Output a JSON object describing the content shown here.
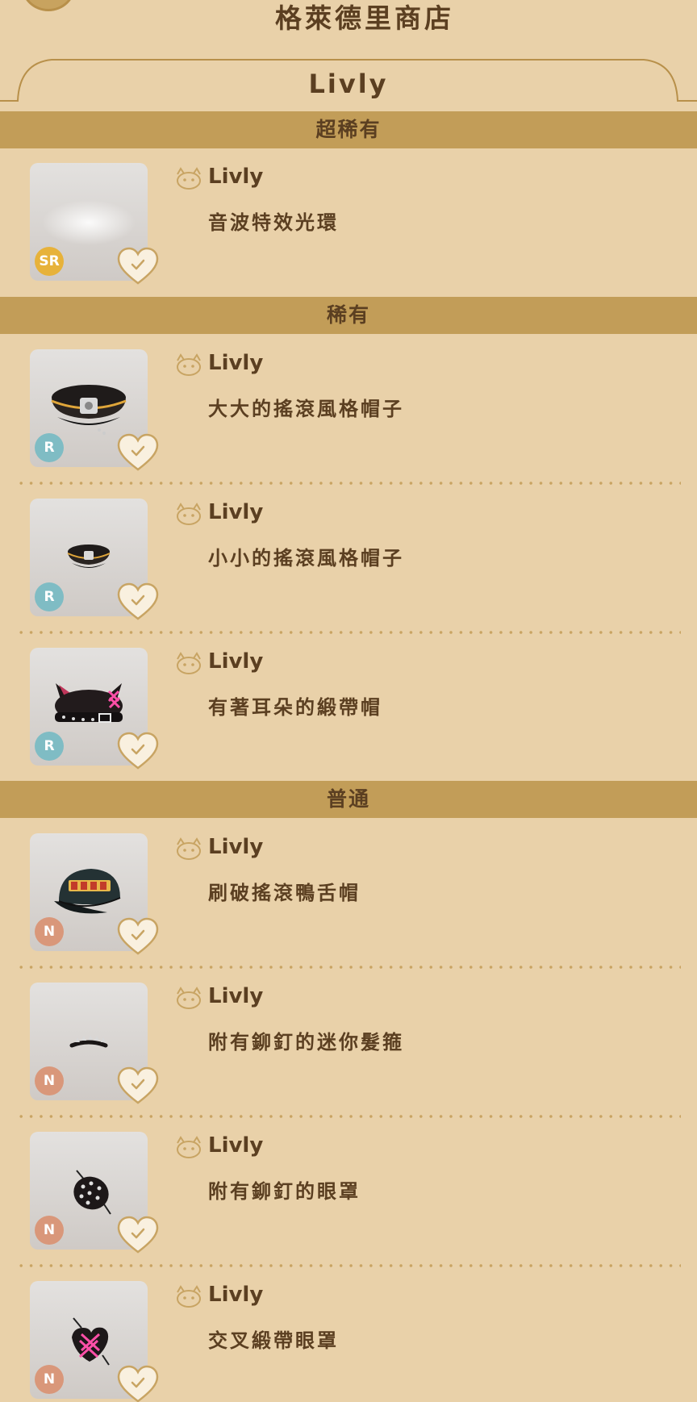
{
  "header": {
    "title": "格萊德里商店"
  },
  "tab": {
    "label": "Livly"
  },
  "colors": {
    "background": "#e9d1a9",
    "section_bar": "#c29d58",
    "text": "#5b3f21",
    "rarity_SR": "#e7b23a",
    "rarity_R": "#7fbcc4",
    "rarity_N": "#d9977a"
  },
  "sections": [
    {
      "label": "超稀有",
      "items": [
        {
          "brand": "Livly",
          "name": "音波特效光環",
          "rarity": "SR",
          "icon": "sound-wave-halo"
        }
      ]
    },
    {
      "label": "稀有",
      "items": [
        {
          "brand": "Livly",
          "name": "大大的搖滾風格帽子",
          "rarity": "R",
          "icon": "big-military-cap"
        },
        {
          "brand": "Livly",
          "name": "小小的搖滾風格帽子",
          "rarity": "R",
          "icon": "small-military-cap"
        },
        {
          "brand": "Livly",
          "name": "有著耳朵的緞帶帽",
          "rarity": "R",
          "icon": "cat-ear-ribbon-hat"
        }
      ]
    },
    {
      "label": "普通",
      "items": [
        {
          "brand": "Livly",
          "name": "刷破搖滾鴨舌帽",
          "rarity": "N",
          "icon": "distressed-rock-cap"
        },
        {
          "brand": "Livly",
          "name": "附有鉚釘的迷你髮箍",
          "rarity": "N",
          "icon": "studded-mini-headband"
        },
        {
          "brand": "Livly",
          "name": "附有鉚釘的眼罩",
          "rarity": "N",
          "icon": "studded-eyepatch"
        },
        {
          "brand": "Livly",
          "name": "交叉緞帶眼罩",
          "rarity": "N",
          "icon": "cross-ribbon-eyepatch"
        }
      ]
    }
  ]
}
